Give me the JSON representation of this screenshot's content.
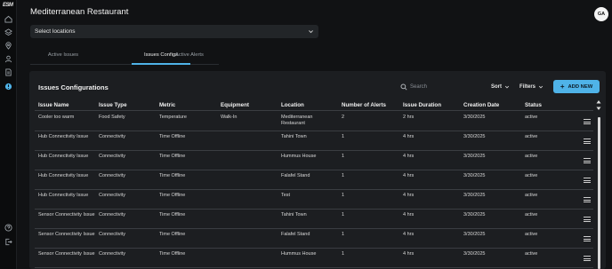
{
  "rail": {
    "logo": "ESM",
    "icons": [
      "home-icon",
      "layers-icon",
      "location-pin-icon",
      "user-icon",
      "document-icon",
      "alerts-icon",
      "help-icon",
      "logout-icon"
    ]
  },
  "header": {
    "title": "Mediterranean Restaurant",
    "avatar_initials": "GA"
  },
  "location_select": {
    "placeholder": "Select locations"
  },
  "tabs": [
    {
      "label": "Active Issues",
      "active": false
    },
    {
      "label": "Issues Configs",
      "active": true
    },
    {
      "label": "Active Alerts",
      "active": false
    }
  ],
  "panel": {
    "title": "Issues Configurations",
    "search_placeholder": "Search",
    "sort_label": "Sort",
    "filters_label": "Filters",
    "add_label": "ADD NEW"
  },
  "table": {
    "columns": [
      "Issue Name",
      "Issue Type",
      "Metric",
      "Equipment",
      "Location",
      "Number of Alerts",
      "Issue Duration",
      "Creation Date",
      "Status"
    ],
    "rows": [
      [
        "Cooler too warm",
        "Food Safety",
        "Temperature",
        "Walk-In",
        "Mediterranean Restaurant",
        "2",
        "2 hrs",
        "3/30/2025",
        "active"
      ],
      [
        "Hub Connectivity Issue",
        "Connectivity",
        "Time Offline",
        "",
        "Tahini Town",
        "1",
        "4 hrs",
        "3/30/2025",
        "active"
      ],
      [
        "Hub Connectivity Issue",
        "Connectivity",
        "Time Offline",
        "",
        "Hummus House",
        "1",
        "4 hrs",
        "3/30/2025",
        "active"
      ],
      [
        "Hub Connectivity Issue",
        "Connectivity",
        "Time Offline",
        "",
        "Falafel Stand",
        "1",
        "4 hrs",
        "3/30/2025",
        "active"
      ],
      [
        "Hub Connectivity Issue",
        "Connectivity",
        "Time Offline",
        "",
        "Test",
        "1",
        "4 hrs",
        "3/30/2025",
        "active"
      ],
      [
        "Sensor Connectivity Issue",
        "Connectivity",
        "Time Offline",
        "",
        "Tahini Town",
        "1",
        "4 hrs",
        "3/30/2025",
        "active"
      ],
      [
        "Sensor Connectivity Issue",
        "Connectivity",
        "Time Offline",
        "",
        "Falafel Stand",
        "1",
        "4 hrs",
        "3/30/2025",
        "active"
      ],
      [
        "Sensor Connectivity Issue",
        "Connectivity",
        "Time Offline",
        "",
        "Hummus House",
        "1",
        "4 hrs",
        "3/30/2025",
        "active"
      ]
    ]
  },
  "colors": {
    "accent": "#4fb3e8",
    "background": "#111214",
    "panel": "#1c1e21"
  }
}
